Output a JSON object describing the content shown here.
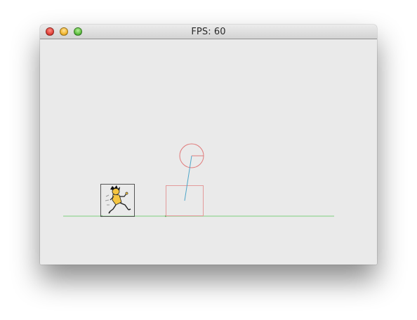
{
  "window": {
    "title": "FPS: 60"
  },
  "scene": {
    "colors": {
      "ground": "#7dcf7d",
      "box": "#e39a9a",
      "pendulum_circle": "#e07a7a",
      "pendulum_line": "#4fa6c8",
      "sprite_border": "#555555",
      "sprite_body": "#f5c542",
      "background": "#eaeaea"
    },
    "icons": {
      "sprite": "running-caveman-icon"
    }
  }
}
